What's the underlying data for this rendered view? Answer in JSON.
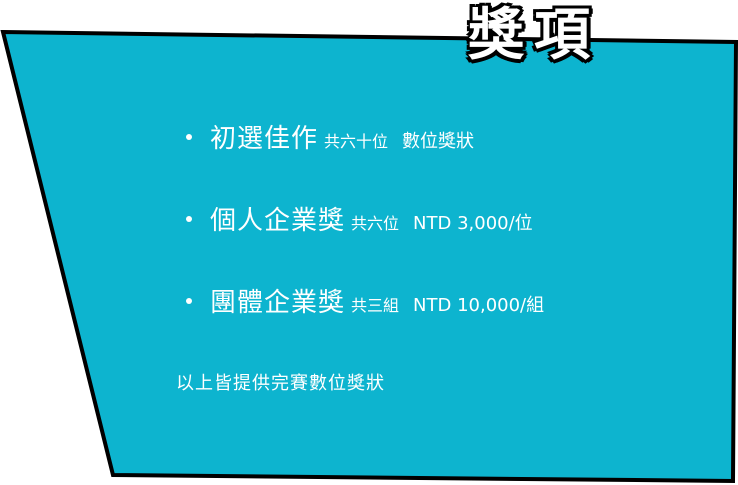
{
  "title": "獎項",
  "colors": {
    "panel": "#0db4cf",
    "outline": "#000000",
    "text": "#ffffff"
  },
  "awards": [
    {
      "name": "初選佳作",
      "count": "共六十位",
      "prize": "數位獎狀"
    },
    {
      "name": "個人企業獎",
      "count": "共六位",
      "prize": "NTD 3,000/位"
    },
    {
      "name": "團體企業獎",
      "count": "共三組",
      "prize": "NTD 10,000/組"
    }
  ],
  "footnote": "以上皆提供完賽數位獎狀"
}
